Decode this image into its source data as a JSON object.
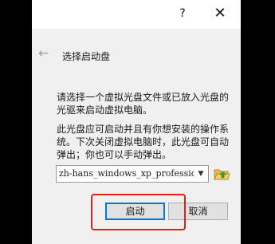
{
  "titlebar": {
    "help_label": "?",
    "close_label": "✕"
  },
  "header": {
    "back_glyph": "←",
    "title": "选择启动盘"
  },
  "body": {
    "paragraph1": "请选择一个虚拟光盘文件或已放入光盘的光驱来启动虚拟电脑。",
    "paragraph2": "此光盘应可启动并且有你想安装的操作系统。下次关闭虚拟电脑时，此光盘可自动弹出；你也可以手动弹出。"
  },
  "disk_select": {
    "selected_value": "zh-hans_windows_xp_professional",
    "arrow_glyph": "▼",
    "folder_icon": "folder-open-icon"
  },
  "buttons": {
    "start_label": "启动",
    "cancel_label": "取消"
  },
  "colors": {
    "highlight": "#e02020",
    "focus": "#0078d7",
    "folder": "#e8b84a",
    "folder_arrow": "#3aa640"
  }
}
